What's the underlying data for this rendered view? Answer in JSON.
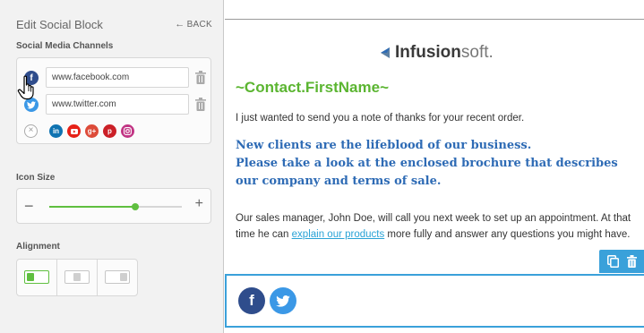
{
  "panel": {
    "title": "Edit Social Block",
    "back_label": "BACK",
    "social_section_label": "Social Media Channels",
    "channels": [
      {
        "network": "facebook",
        "value": "www.facebook.com",
        "icon": "facebook-icon"
      },
      {
        "network": "twitter",
        "value": "www.twitter.com",
        "icon": "twitter-icon"
      }
    ],
    "available_networks": [
      "linkedin",
      "youtube",
      "google-plus",
      "pinterest",
      "instagram"
    ],
    "icon_size_label": "Icon Size",
    "icon_size_level": 0.65,
    "alignment_label": "Alignment",
    "alignment_options": [
      "left",
      "center",
      "right"
    ],
    "alignment_selected": "left"
  },
  "email": {
    "logo_bold": "Infusion",
    "logo_light": "soft.",
    "merge_field": "~Contact.FirstName~",
    "intro": "I just wanted to send you a note of thanks for your recent order.",
    "headline_line1": "New clients are the lifeblood of our business.",
    "headline_line2": "Please take a look at the enclosed brochure that describes our company and terms of sale.",
    "body_before_link": "Our sales manager, John Doe, will call you next week to set up an appointment. At that time he can ",
    "body_link": "explain our products",
    "body_after_link": " more fully and answer any questions you might have."
  },
  "colors": {
    "accent_green": "#5fbf3f",
    "selection_blue": "#3aa1da",
    "headline_blue": "#2e6bb5",
    "facebook": "#2f4d8c",
    "twitter": "#3b98e6"
  }
}
